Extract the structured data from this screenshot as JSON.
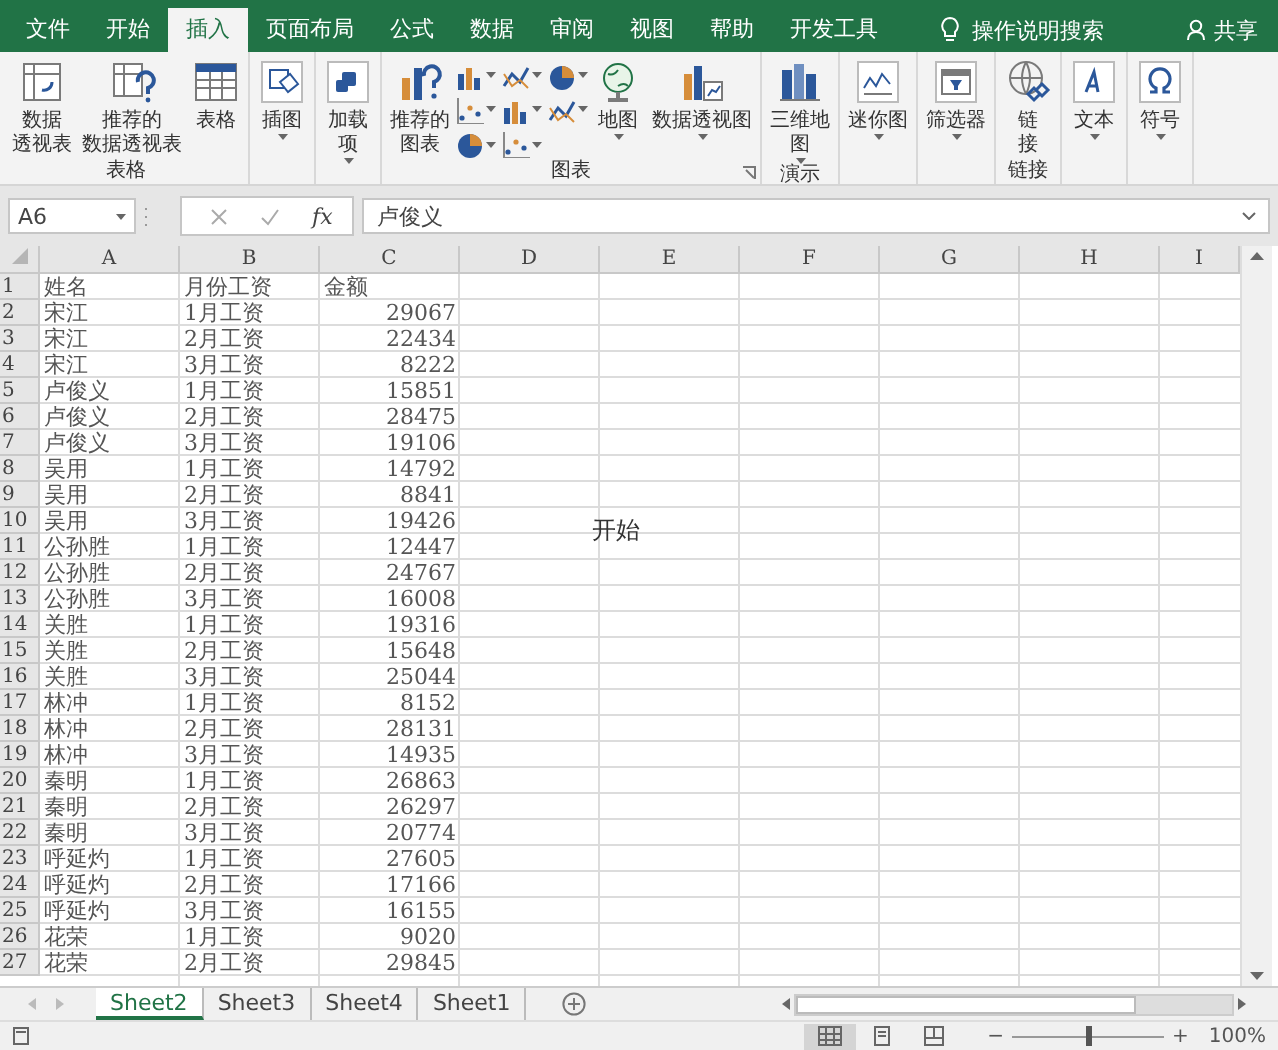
{
  "ribbon_tabs": [
    {
      "label": "文件",
      "selected": false
    },
    {
      "label": "开始",
      "selected": false
    },
    {
      "label": "插入",
      "selected": true
    },
    {
      "label": "页面布局",
      "selected": false
    },
    {
      "label": "公式",
      "selected": false
    },
    {
      "label": "数据",
      "selected": false
    },
    {
      "label": "审阅",
      "selected": false
    },
    {
      "label": "视图",
      "selected": false
    },
    {
      "label": "帮助",
      "selected": false
    },
    {
      "label": "开发工具",
      "selected": false
    }
  ],
  "tell_me": "操作说明搜索",
  "share": "共享",
  "ribbon_groups": [
    {
      "label": "表格",
      "items": [
        {
          "kind": "large",
          "lines": [
            "数据",
            "透视表"
          ],
          "dropdown": false
        },
        {
          "kind": "large",
          "lines": [
            "推荐的",
            "数据透视表"
          ],
          "dropdown": false
        },
        {
          "kind": "large",
          "lines": [
            "表格"
          ],
          "dropdown": false
        }
      ]
    },
    {
      "items": [
        {
          "kind": "large",
          "lines": [
            "插图"
          ],
          "dropdown": true
        }
      ]
    },
    {
      "items": [
        {
          "kind": "large",
          "lines": [
            "加载",
            "项"
          ],
          "dropdown": true
        }
      ]
    },
    {
      "label": "图表",
      "launcher": true,
      "items": [
        {
          "kind": "large",
          "lines": [
            "推荐的",
            "图表"
          ],
          "dropdown": false
        },
        {
          "kind": "chart-grid"
        },
        {
          "kind": "large",
          "lines": [
            "地图"
          ],
          "dropdown": true
        },
        {
          "kind": "large",
          "lines": [
            "数据透视图"
          ],
          "dropdown": true
        }
      ]
    },
    {
      "label": "演示",
      "items": [
        {
          "kind": "large",
          "lines": [
            "三维地",
            "图"
          ],
          "dropdown": true
        }
      ]
    },
    {
      "items": [
        {
          "kind": "large",
          "lines": [
            "迷你图"
          ],
          "dropdown": true
        }
      ]
    },
    {
      "items": [
        {
          "kind": "large",
          "lines": [
            "筛选器"
          ],
          "dropdown": true
        }
      ]
    },
    {
      "label": "链接",
      "items": [
        {
          "kind": "large",
          "lines": [
            "链",
            "接"
          ],
          "dropdown": false
        }
      ]
    },
    {
      "items": [
        {
          "kind": "large",
          "lines": [
            "文本"
          ],
          "dropdown": true
        }
      ]
    },
    {
      "items": [
        {
          "kind": "large",
          "lines": [
            "符号"
          ],
          "dropdown": true
        }
      ]
    }
  ],
  "formula_bar": {
    "name_box": "A6",
    "function_label": "fx",
    "value": "卢俊义"
  },
  "columns": [
    "A",
    "B",
    "C",
    "D",
    "E",
    "F",
    "G",
    "H",
    "I"
  ],
  "rows": [
    [
      "1",
      "姓名",
      "月份工资",
      "金额"
    ],
    [
      "2",
      "宋江",
      "1月工资",
      "29067"
    ],
    [
      "3",
      "宋江",
      "2月工资",
      "22434"
    ],
    [
      "4",
      "宋江",
      "3月工资",
      "8222"
    ],
    [
      "5",
      "卢俊义",
      "1月工资",
      "15851"
    ],
    [
      "6",
      "卢俊义",
      "2月工资",
      "28475"
    ],
    [
      "7",
      "卢俊义",
      "3月工资",
      "19106"
    ],
    [
      "8",
      "吴用",
      "1月工资",
      "14792"
    ],
    [
      "9",
      "吴用",
      "2月工资",
      "8841"
    ],
    [
      "10",
      "吴用",
      "3月工资",
      "19426"
    ],
    [
      "11",
      "公孙胜",
      "1月工资",
      "12447"
    ],
    [
      "12",
      "公孙胜",
      "2月工资",
      "24767"
    ],
    [
      "13",
      "公孙胜",
      "3月工资",
      "16008"
    ],
    [
      "14",
      "关胜",
      "1月工资",
      "19316"
    ],
    [
      "15",
      "关胜",
      "2月工资",
      "15648"
    ],
    [
      "16",
      "关胜",
      "3月工资",
      "25044"
    ],
    [
      "17",
      "林冲",
      "1月工资",
      "8152"
    ],
    [
      "18",
      "林冲",
      "2月工资",
      "28131"
    ],
    [
      "19",
      "林冲",
      "3月工资",
      "14935"
    ],
    [
      "20",
      "秦明",
      "1月工资",
      "26863"
    ],
    [
      "21",
      "秦明",
      "2月工资",
      "26297"
    ],
    [
      "22",
      "秦明",
      "3月工资",
      "20774"
    ],
    [
      "23",
      "呼延灼",
      "1月工资",
      "27605"
    ],
    [
      "24",
      "呼延灼",
      "2月工资",
      "17166"
    ],
    [
      "25",
      "呼延灼",
      "3月工资",
      "16155"
    ],
    [
      "26",
      "花荣",
      "1月工资",
      "9020"
    ],
    [
      "27",
      "花荣",
      "2月工资",
      "29845"
    ]
  ],
  "caption": "开始",
  "sheets": [
    {
      "label": "Sheet2",
      "selected": true
    },
    {
      "label": "Sheet3",
      "selected": false
    },
    {
      "label": "Sheet4",
      "selected": false
    },
    {
      "label": "Sheet1",
      "selected": false
    }
  ],
  "status_bar": {
    "views": [
      {
        "selected": true
      },
      {
        "selected": false
      },
      {
        "selected": false
      }
    ],
    "zoom_out": "−",
    "zoom_in": "+",
    "zoom": {
      "level": 0.5
    },
    "zoom_label": "100%"
  }
}
